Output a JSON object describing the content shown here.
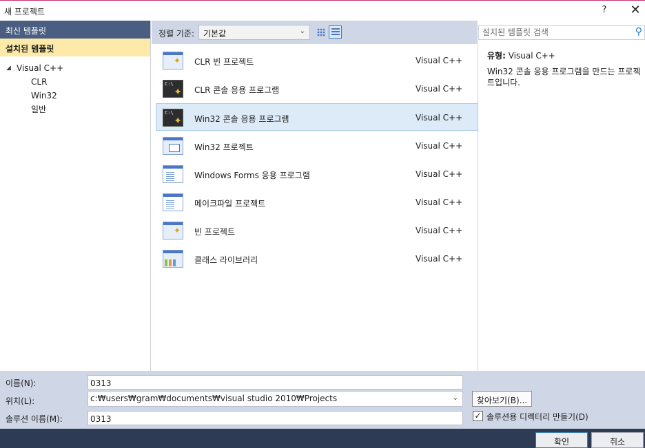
{
  "window": {
    "title": "새 프로젝트",
    "help": "?",
    "close": "✕"
  },
  "left_panel": {
    "recent": "최신 템플릿",
    "installed": "설치된 템플릿",
    "tree": {
      "root": "Visual C++",
      "children": [
        "CLR",
        "Win32",
        "일반"
      ]
    }
  },
  "filter": {
    "sort_label": "정렬 기준:",
    "sort_value": "기본값"
  },
  "search": {
    "placeholder": "설치된 템플릿 검색"
  },
  "templates": [
    {
      "name": "CLR 빈 프로젝트",
      "lang": "Visual C++",
      "icon": "window-icon",
      "selected": false
    },
    {
      "name": "CLR 콘솔 응용 프로그램",
      "lang": "Visual C++",
      "icon": "console-icon",
      "selected": false
    },
    {
      "name": "Win32 콘솔 응용 프로그램",
      "lang": "Visual C++",
      "icon": "console-icon",
      "selected": true
    },
    {
      "name": "Win32 프로젝트",
      "lang": "Visual C++",
      "icon": "stacked-window-icon",
      "selected": false
    },
    {
      "name": "Windows Forms 응용 프로그램",
      "lang": "Visual C++",
      "icon": "form-icon",
      "selected": false
    },
    {
      "name": "메이크파일 프로젝트",
      "lang": "Visual C++",
      "icon": "document-icon",
      "selected": false
    },
    {
      "name": "빈 프로젝트",
      "lang": "Visual C++",
      "icon": "window-icon",
      "selected": false
    },
    {
      "name": "클래스 라이브러리",
      "lang": "Visual C++",
      "icon": "library-icon",
      "selected": false
    }
  ],
  "description": {
    "type_label": "유형:",
    "type_value": "Visual C++",
    "text": "Win32 콘솔 응용 프로그램을 만드는 프로젝트입니다."
  },
  "form": {
    "name_label": "이름(N):",
    "name_value": "0313",
    "location_label": "위치(L):",
    "location_value": "c:₩users₩gram₩documents₩visual studio 2010₩Projects",
    "solution_label": "솔루션 이름(M):",
    "solution_value": "0313",
    "browse_label": "찾아보기(B)...",
    "create_dir_label": "솔루션용 디렉터리 만들기(D)",
    "create_dir_checked": true,
    "check_mark": "✓"
  },
  "footer": {
    "ok": "확인",
    "cancel": "취소"
  },
  "colors": {
    "title_accent": "#c2336e",
    "panel_bg": "#cfd6e5",
    "recent_bg": "#4a5e82",
    "installed_bg": "#fde9a8",
    "selected_bg": "#dcebf7",
    "footer_bg": "#2e3b55"
  }
}
